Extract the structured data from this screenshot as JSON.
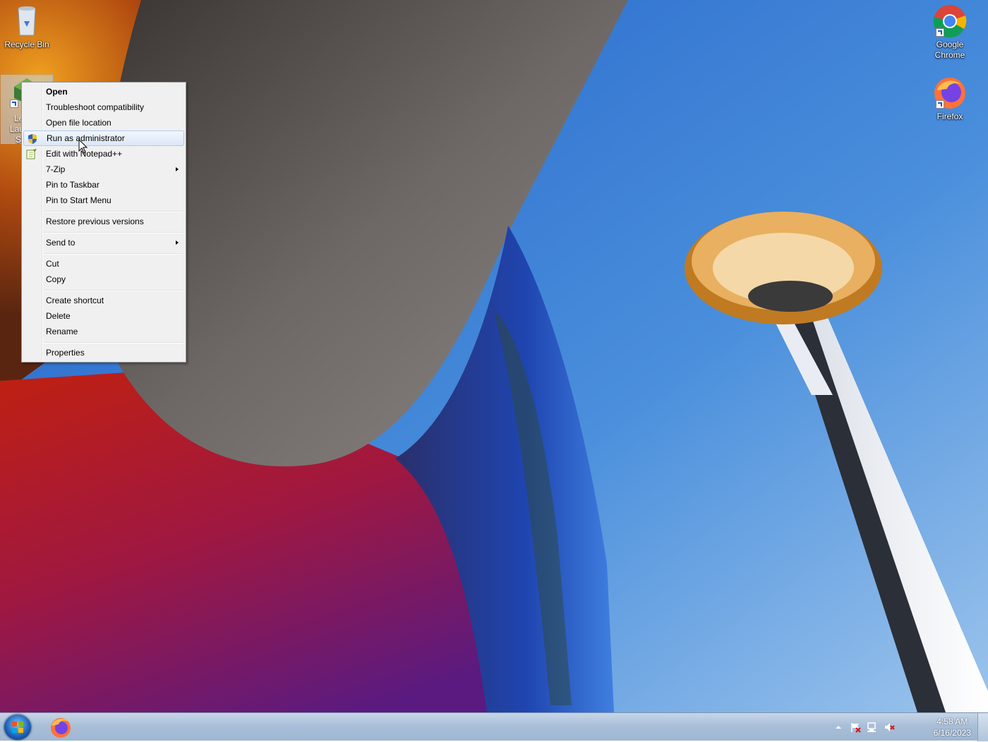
{
  "desktop": {
    "icons": [
      {
        "label": "Recycle Bin",
        "icon": "recycle-bin-icon"
      },
      {
        "label": "Google Chrome",
        "icon": "chrome-icon"
      },
      {
        "label": "Firefox",
        "icon": "firefox-icon"
      }
    ],
    "selected_icon_label_fragments": [
      "Le",
      "Lau",
      "St"
    ]
  },
  "context_menu": {
    "items": [
      {
        "label": "Open",
        "bold": true
      },
      {
        "label": "Troubleshoot compatibility"
      },
      {
        "label": "Open file location"
      },
      {
        "label": "Run as administrator",
        "icon": "uac-shield-icon",
        "hover": true
      },
      {
        "label": "Edit with Notepad++",
        "icon": "notepadpp-icon"
      },
      {
        "label": "7-Zip",
        "submenu": true
      },
      {
        "label": "Pin to Taskbar"
      },
      {
        "label": "Pin to Start Menu"
      },
      {
        "label": "Restore previous versions"
      },
      {
        "label": "Send to",
        "submenu": true
      },
      {
        "label": "Cut"
      },
      {
        "label": "Copy"
      },
      {
        "label": "Create shortcut"
      },
      {
        "label": "Delete"
      },
      {
        "label": "Rename"
      },
      {
        "label": "Properties"
      }
    ]
  },
  "taskbar": {
    "start_icon": "windows-orb-icon",
    "pinned": [
      {
        "icon": "firefox-icon"
      }
    ],
    "tray_icons": [
      "show-hidden-icons-icon",
      "action-center-flag-icon",
      "network-icon",
      "volume-muted-icon"
    ],
    "clock": {
      "time": "4:58 AM",
      "date": "6/16/2023"
    }
  },
  "colors": {
    "sky": "#3f86d8",
    "menu_bg": "#f0f0f0",
    "menu_hover_border": "#aeccef",
    "taskbar": "#a9bfd8"
  }
}
